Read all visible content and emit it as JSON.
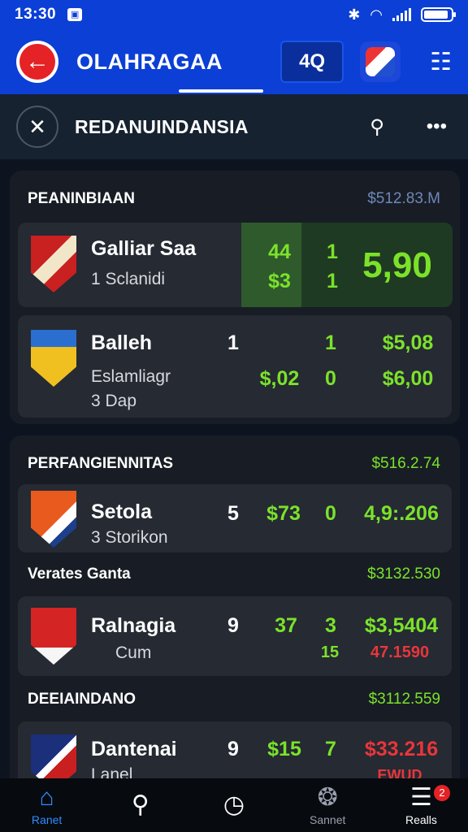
{
  "status_bar": {
    "time": "13:30",
    "notif_glyph": "▣",
    "bluetooth": "✱",
    "wifi": "◠"
  },
  "app_bar": {
    "title": "OLAHRAGAA",
    "score_box": "4Q"
  },
  "sub_header": {
    "title": "REDANUINDANSIA"
  },
  "sections": [
    {
      "header": "PEANINBIAAN",
      "value": "$512.83.M",
      "rows": [
        {
          "team": "Galliar Saa",
          "sub": "1 Sclanidi",
          "c1": "44",
          "c2": "1",
          "c1b": "$3",
          "c2b": "1",
          "big": "5,90"
        },
        {
          "team": "Balleh",
          "sub": "Eslamliagr",
          "sub2": "3 Dap",
          "n1": "1",
          "n2": "1",
          "n3": "$5,08",
          "m1": "$,02",
          "m2": "0",
          "m3": "$6,00"
        }
      ]
    },
    {
      "header": "PERFANGIENNITAS",
      "value": "$516.2.74",
      "rows": [
        {
          "team": "Setola",
          "sub": "3 Storikon",
          "n1": "5",
          "n2": "$73",
          "n3": "0",
          "n4": "4,9:.206"
        }
      ]
    },
    {
      "header": "Verates Ganta",
      "value": "$3132.530",
      "rows": [
        {
          "team": "Ralnagia",
          "sub": "Cum",
          "n1": "9",
          "n2": "37",
          "n3": "3",
          "n4": "$3,5404",
          "m3": "15",
          "m4": "47.1590"
        }
      ]
    },
    {
      "header": "DEEIAINDANO",
      "value": "$3112.559",
      "rows": [
        {
          "team": "Dantenai",
          "sub": "Lanel",
          "n1": "9",
          "n2": "$15",
          "n3": "7",
          "n4": "$33.216",
          "m4": "EWUD"
        }
      ]
    }
  ],
  "bottom_nav": [
    {
      "label": "Ranet",
      "icon": "home-icon"
    },
    {
      "label": "",
      "icon": "search-icon"
    },
    {
      "label": "",
      "icon": "clock-icon"
    },
    {
      "label": "Sannet",
      "icon": "group-icon"
    },
    {
      "label": "Realls",
      "icon": "list-icon",
      "badge": "2"
    }
  ]
}
